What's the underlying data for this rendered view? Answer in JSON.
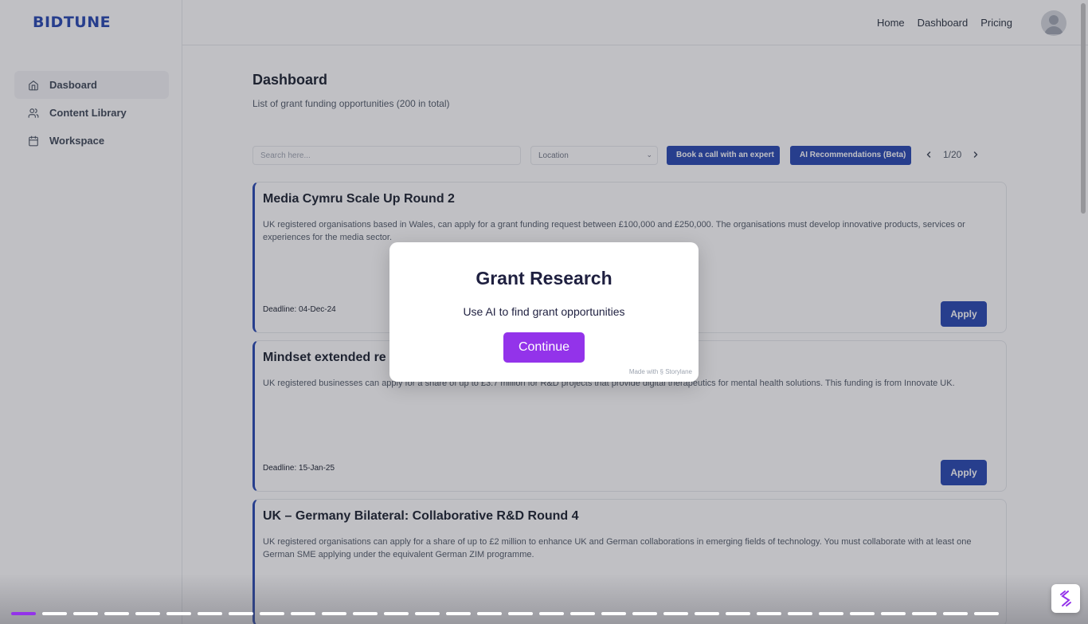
{
  "app": {
    "logo": "BIDTUNE"
  },
  "header": {
    "nav": [
      "Home",
      "Dashboard",
      "Pricing"
    ]
  },
  "sidebar": {
    "items": [
      {
        "label": "Dasboard",
        "icon": "home-icon",
        "active": true
      },
      {
        "label": "Content Library",
        "icon": "users-icon",
        "active": false
      },
      {
        "label": "Workspace",
        "icon": "calendar-icon",
        "active": false
      }
    ]
  },
  "main": {
    "title": "Dashboard",
    "subtitle": "List of grant funding opportunities (200 in total)",
    "search_placeholder": "Search here...",
    "location_placeholder": "Location",
    "book_call_label": "Book a call with an expert",
    "ai_label": "AI Recommendations (Beta)",
    "page": "1/20",
    "cards": [
      {
        "title": "Media Cymru Scale Up Round 2",
        "description": "UK registered organisations based in Wales, can apply for a grant funding request between £100,000 and £250,000. The organisations must develop innovative products, services or experiences for the media sector.",
        "deadline": "Deadline: 04-Dec-24",
        "apply": "Apply"
      },
      {
        "title": "Mindset extended re",
        "description": "UK registered businesses can apply for a share of up to £3.7 million for R&D projects that provide digital therapeutics for mental health solutions. This funding is from Innovate UK.",
        "deadline": "Deadline: 15-Jan-25",
        "apply": "Apply"
      },
      {
        "title": "UK – Germany Bilateral: Collaborative R&D Round 4",
        "description": "UK registered organisations can apply for a share of up to £2 million to enhance UK and German collaborations in emerging fields of technology. You must collaborate with at least one German SME applying under the equivalent German ZIM programme.",
        "deadline": "",
        "apply": ""
      }
    ]
  },
  "modal": {
    "title": "Grant Research",
    "text": "Use AI to find grant opportunities",
    "button": "Continue",
    "made_with": "Made with",
    "brand": "Storylane"
  },
  "progress": {
    "total_steps": 32,
    "current_step": 1
  },
  "colors": {
    "brand_blue": "#1e40af",
    "accent_purple": "#9333ea"
  }
}
